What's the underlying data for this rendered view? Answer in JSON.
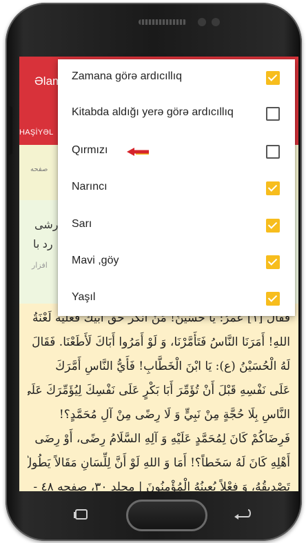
{
  "app": {
    "title": "Əlam",
    "tab_label": "HAŞİYƏL"
  },
  "background": {
    "band1_text": "صفحه",
    "band2_lines": [
      "رشی",
      "رد با"
    ],
    "band2_small": "افزار",
    "arabic_lines": [
      "فقال [١] عمرُ: يا حُسَيْنُ! مَنْ أنكر حق أبيك فعليه لَعْنَةُ",
      "اللهِ! أَمَرَنَا النَّاسُ فَتَأَمَّرْنَا، وَ لَوْ أَمَرُوا أَبَاكَ لَأَطَعْنَا. فَقَالَ",
      "لَهُ الْحُسَيْنُ (ع): يَا ابْنَ الْخَطَّابِ! فَأَيُّ النَّاسِ أَمَّرَكَ",
      "عَلَى نَفْسِهِ قَبْلَ أَنْ تُؤَمِّرَ أَبَا بَكْرٍ عَلَى نَفْسِكَ لِيُؤَمِّرَكَ عَلَى",
      "النَّاسِ بِلَا حُجَّةٍ مِنْ نَبِيٍّ وَ لَا رِضًى مِنْ آلِ مُحَمَّدٍ؟!",
      "فَرِضَاكُمْ كَانَ لِمُحَمَّدٍ عَلَيْهِ وَ آلِهِ السَّلَامُ رِضًى، أَوْ رِضَى",
      "أَهْلِهِ كَانَ لَهُ سَخَطاً؟! أَمَا وَ اللهِ لَوْ أَنَّ لِلِّسَانِ مَقَالاً يَطُولُ",
      "تَصْدِيقُهُ، وَ فِعْلاً يُعِينُهُ الْمُؤْمِنُونَ | مجلد ٣٠، صفحه ٤٨ -"
    ]
  },
  "menu": {
    "items": [
      {
        "label": "Zamana görə ardıcıllıq",
        "checked": true
      },
      {
        "label": "Kitabda aldığı yerə görə ardıcıllıq",
        "checked": false
      },
      {
        "label": "Qırmızı",
        "checked": false
      },
      {
        "label": "Narıncı",
        "checked": true
      },
      {
        "label": "Sarı",
        "checked": true
      },
      {
        "label": "Mavi ,göy",
        "checked": true
      },
      {
        "label": "Yaşıl",
        "checked": true
      }
    ]
  },
  "colors": {
    "app_bar": "#d8323a",
    "checkbox_checked": "#f7bd1d",
    "annotation_arrow": "#d6242b",
    "page_background": "#fdf0c8"
  },
  "icons": {
    "annotation": "left-arrow-icon",
    "nav_back": "back-icon",
    "nav_home": "home-button",
    "nav_recent": "recent-apps-icon"
  }
}
